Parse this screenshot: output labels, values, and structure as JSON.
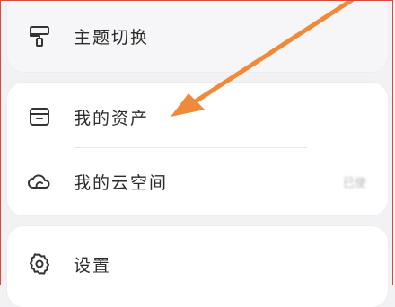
{
  "settings_list": {
    "theme_switch": {
      "label": "主题切换",
      "value": ""
    },
    "my_assets": {
      "label": "我的资产"
    },
    "my_cloud_space": {
      "label": "我的云空间",
      "value": "已使"
    },
    "settings": {
      "label": "设置"
    }
  },
  "annotation": {
    "type": "arrow",
    "color": "#f08a3a",
    "points_to": "my_assets"
  },
  "colors": {
    "background": "#f2f2f4",
    "card": "#ffffff",
    "text": "#2b2b2b",
    "arrow": "#f08a3a",
    "frame": "#d94a3a"
  },
  "icons": [
    "paint-roller-icon",
    "box-icon",
    "cloud-icon",
    "gear-icon"
  ]
}
